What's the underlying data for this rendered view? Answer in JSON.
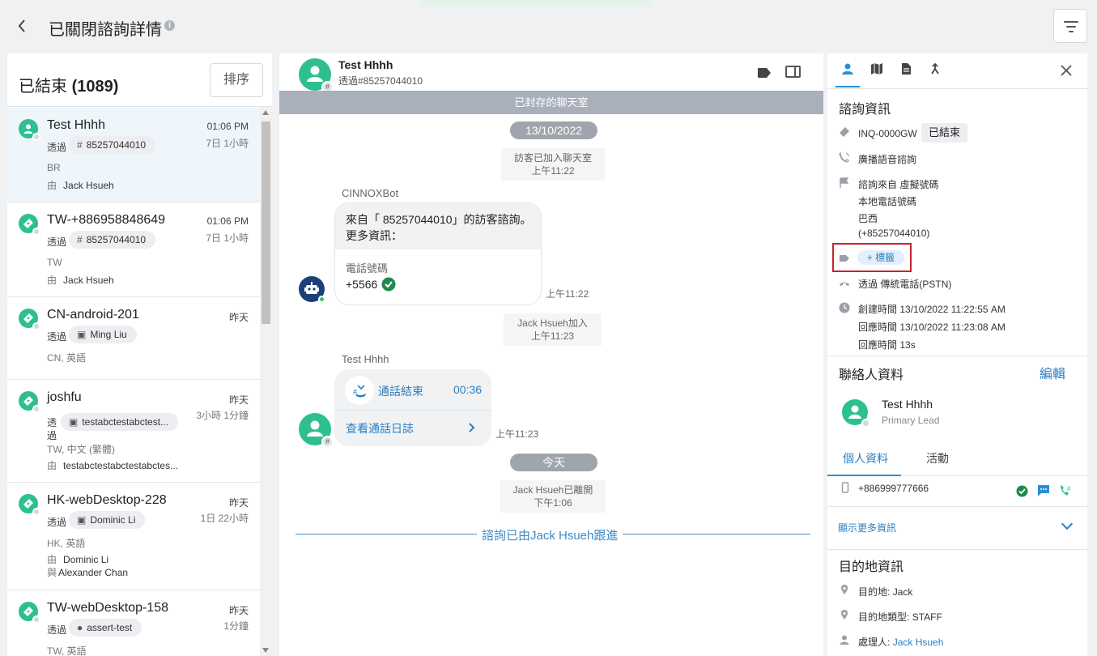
{
  "header": {
    "title": "已關閉諮詢詳情",
    "info_icon": "info-icon",
    "filter_icon": "filter-icon",
    "back_icon": "back-arrow-icon"
  },
  "list": {
    "title": "已結束",
    "count": "(1089)",
    "sort_label": "排序",
    "items": [
      {
        "name": "Test Hhhh",
        "time": "01:06 PM",
        "duration": "7日 1小時",
        "via": "透過",
        "chip": "85257044010",
        "chip_icon": "hash-icon",
        "meta": "BR",
        "by_prefix": "由",
        "by": "Jack Hsueh",
        "icon": "user-icon"
      },
      {
        "name": "TW-+886958848649",
        "time": "01:06 PM",
        "duration": "7日 1小時",
        "via": "透過",
        "chip": "85257044010",
        "chip_icon": "hash-icon",
        "meta": "TW",
        "by_prefix": "由",
        "by": "Jack Hsueh",
        "icon": "ticket-icon"
      },
      {
        "name": "CN-android-201",
        "time": "昨天",
        "duration": "",
        "via": "透過",
        "chip": "Ming Liu",
        "chip_icon": "contact-card-icon",
        "meta": "CN, 英語",
        "icon": "ticket-icon"
      },
      {
        "name": "joshfu",
        "time": "昨天",
        "duration": "3小時 1分鐘",
        "via": "透過",
        "chip": "testabctestabctest...",
        "chip_icon": "contact-card-icon",
        "meta": "TW, 中文 (繁體)",
        "by_prefix": "由",
        "by": "testabctestabctestabctes...",
        "icon": "ticket-icon"
      },
      {
        "name": "HK-webDesktop-228",
        "time": "昨天",
        "duration": "1日 22小時",
        "via": "透過",
        "chip": "Dominic Li",
        "chip_icon": "contact-card-icon",
        "meta": "HK, 英語",
        "by_prefix": "由",
        "by": "Dominic Li",
        "with_prefix": "與",
        "with": "Alexander Chan",
        "icon": "ticket-icon"
      },
      {
        "name": "TW-webDesktop-158",
        "time": "昨天",
        "duration": "1分鐘",
        "via": "透過",
        "chip": "assert-test",
        "chip_icon": "tag-icon",
        "meta": "TW, 英語",
        "icon": "ticket-icon"
      }
    ]
  },
  "chat": {
    "name": "Test Hhhh",
    "sub": "透過#85257044010",
    "archived": "已封存的聊天室",
    "date1": "13/10/2022",
    "sys1": {
      "line1": "訪客已加入聊天室",
      "line2": "上午11:22"
    },
    "bot_sender": "CINNOXBot",
    "bot_msg1": "來自「 85257044010」的訪客諮詢。",
    "bot_msg2": "更多資訊：",
    "bot_field_label": "電話號碼",
    "bot_field_value": "+5566",
    "bot_time": "上午11:22",
    "sys2": {
      "line1": "Jack Hsueh加入",
      "line2": "上午11:23"
    },
    "visitor_sender": "Test Hhhh",
    "call_status": "通話結束",
    "call_duration": "00:36",
    "call_log_link": "查看通話日誌",
    "call_time": "上午11:23",
    "date2": "今天",
    "sys3": {
      "line1": "Jack Hsueh已離開",
      "line2": "下午1:06"
    },
    "follow": "諮詢已由Jack Hsueh跟進"
  },
  "details": {
    "section_title": "諮詢資訊",
    "inquiry_id": "INQ-0000GW",
    "status": "已結束",
    "channel": "廣播語音諮詢",
    "source_label": "諮詢來自",
    "source_1": "虛擬號碼",
    "source_2": "本地電話號碼",
    "source_3": "巴西",
    "source_4": "(+85257044010)",
    "tag_button": "+ 標籤",
    "via_label": "透過",
    "via_value": "傳統電話(PSTN)",
    "created_label": "創建時間",
    "created": "13/10/2022 11:22:55 AM",
    "responded_label": "回應時間",
    "responded": "13/10/2022 11:23:08 AM",
    "response_label": "回應時間",
    "response": "13s"
  },
  "contact": {
    "section_title": "聯絡人資料",
    "edit": "編輯",
    "name": "Test Hhhh",
    "role": "Primary Lead",
    "tab_profile": "個人資料",
    "tab_activity": "活動",
    "phone": "+886999777666",
    "show_more": "顯示更多資訊"
  },
  "destination": {
    "section_title": "目的地資訊",
    "dest_label": "目的地:",
    "dest": "Jack",
    "type_label": "目的地類型:",
    "type": "STAFF",
    "handler_label": "處理人:",
    "handler": "Jack Hsueh"
  },
  "colors": {
    "green": "#2ebf91",
    "blue": "#2a8fd8",
    "red_highlight": "#c8222d"
  }
}
